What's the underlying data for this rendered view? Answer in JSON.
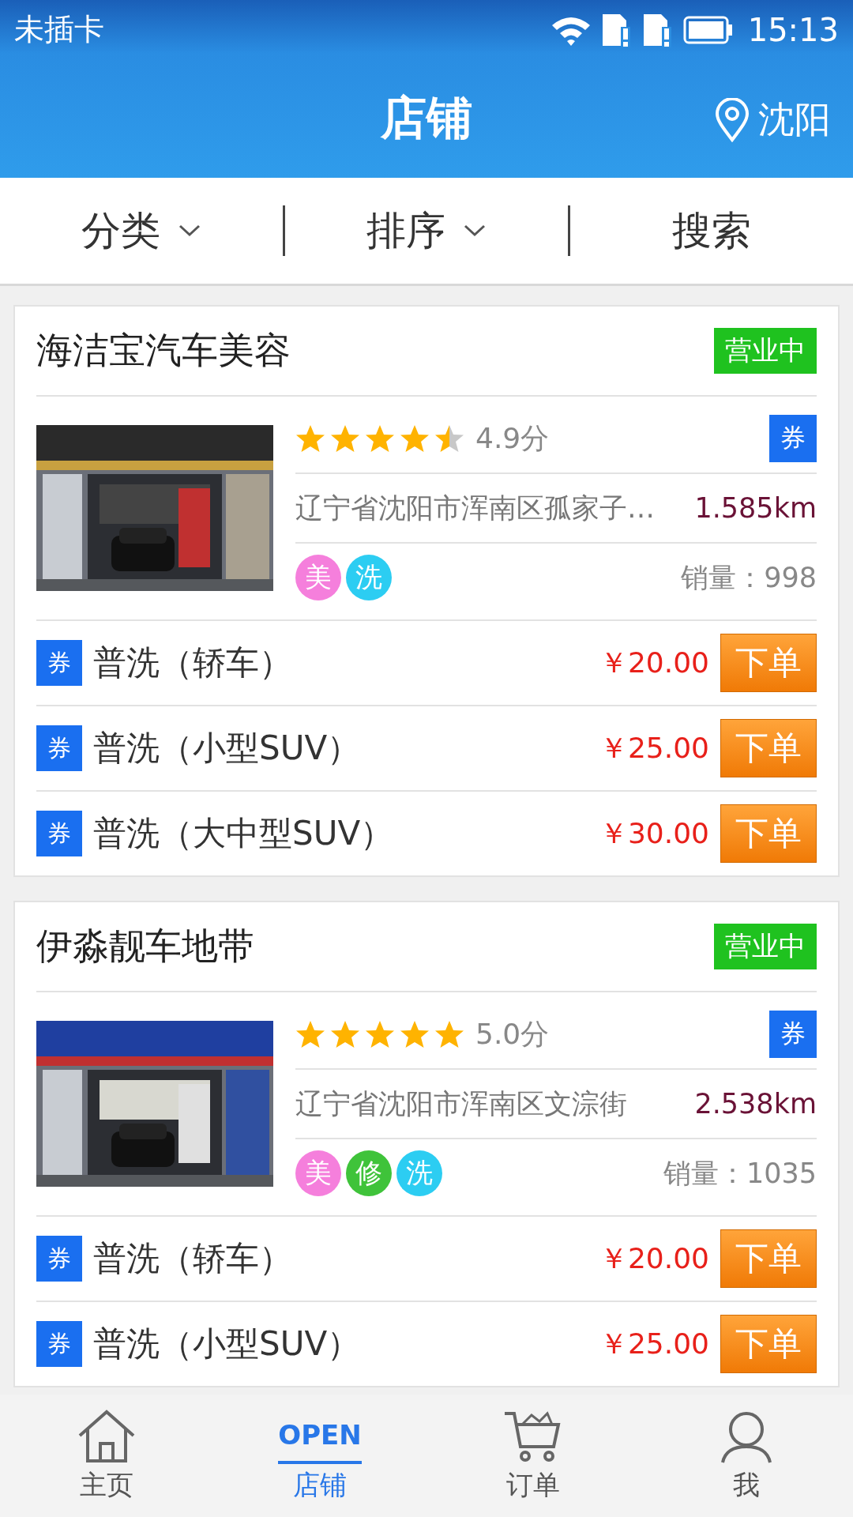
{
  "status_bar": {
    "carrier": "未插卡",
    "time": "15:13"
  },
  "header": {
    "title": "店铺",
    "city": "沈阳"
  },
  "filters": [
    {
      "label": "分类",
      "kind": "dropdown"
    },
    {
      "label": "排序",
      "kind": "dropdown"
    },
    {
      "label": "搜索",
      "kind": "plain"
    }
  ],
  "shops": [
    {
      "name": "海洁宝汽车美容",
      "status": "营业中",
      "picture": {
        "kind": "picture"
      },
      "stars": 4.5,
      "score": "4.9分",
      "coupon": "券",
      "address": "辽宁省沈阳市浑南区孤家子…",
      "distance": "1.585km",
      "tags": [
        {
          "label": "美",
          "color": "#f57fdc"
        },
        {
          "label": "洗",
          "color": "#2ccdf2"
        }
      ],
      "sales": "销量：998",
      "services": [
        {
          "coupon": "券",
          "name": "普洗（轿车）",
          "price": "￥20.00",
          "action": "下单"
        },
        {
          "coupon": "券",
          "name": "普洗（小型SUV）",
          "price": "￥25.00",
          "action": "下单"
        },
        {
          "coupon": "券",
          "name": "普洗（大中型SUV）",
          "price": "￥30.00",
          "action": "下单"
        }
      ]
    },
    {
      "name": "伊淼靓车地带",
      "status": "营业中",
      "picture": {
        "kind": "picture"
      },
      "stars": 5,
      "score": "5.0分",
      "coupon": "券",
      "address": "辽宁省沈阳市浑南区文淙街",
      "distance": "2.538km",
      "tags": [
        {
          "label": "美",
          "color": "#f57fdc"
        },
        {
          "label": "修",
          "color": "#3fc33a"
        },
        {
          "label": "洗",
          "color": "#2ccdf2"
        }
      ],
      "sales": "销量：1035",
      "services": [
        {
          "coupon": "券",
          "name": "普洗（轿车）",
          "price": "￥20.00",
          "action": "下单"
        },
        {
          "coupon": "券",
          "name": "普洗（小型SUV）",
          "price": "￥25.00",
          "action": "下单"
        }
      ]
    }
  ],
  "nav": [
    {
      "label": "主页",
      "kind": "home",
      "selected": false
    },
    {
      "label": "店铺",
      "kind": "store",
      "icon_text": "OPEN",
      "selected": true
    },
    {
      "label": "订单",
      "kind": "cart",
      "selected": false
    },
    {
      "label": "我",
      "kind": "profile",
      "selected": false
    }
  ]
}
